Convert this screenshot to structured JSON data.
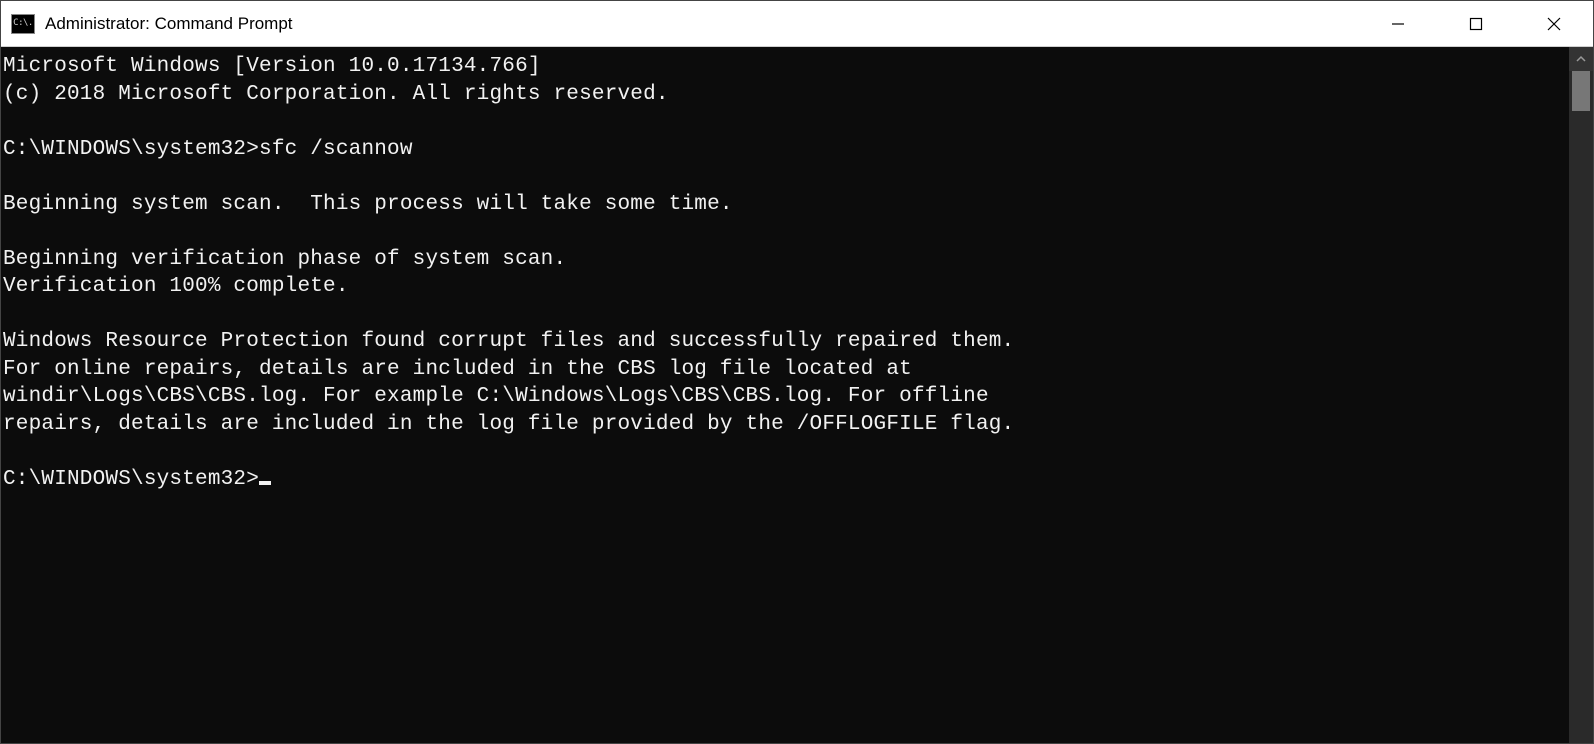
{
  "window": {
    "icon_label": "C:\\.",
    "title": "Administrator: Command Prompt"
  },
  "console": {
    "lines": [
      "Microsoft Windows [Version 10.0.17134.766]",
      "(c) 2018 Microsoft Corporation. All rights reserved.",
      "",
      "C:\\WINDOWS\\system32>sfc /scannow",
      "",
      "Beginning system scan.  This process will take some time.",
      "",
      "Beginning verification phase of system scan.",
      "Verification 100% complete.",
      "",
      "Windows Resource Protection found corrupt files and successfully repaired them.",
      "For online repairs, details are included in the CBS log file located at",
      "windir\\Logs\\CBS\\CBS.log. For example C:\\Windows\\Logs\\CBS\\CBS.log. For offline",
      "repairs, details are included in the log file provided by the /OFFLOGFILE flag.",
      ""
    ],
    "prompt": "C:\\WINDOWS\\system32>"
  }
}
